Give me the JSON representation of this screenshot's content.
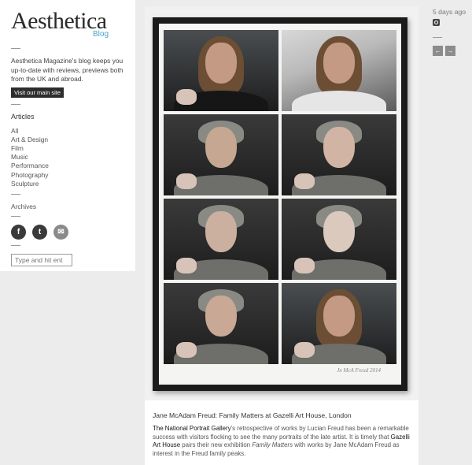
{
  "brand": {
    "name": "Aesthetica",
    "sub": "Blog"
  },
  "sidebar": {
    "intro": "Aesthetica Magazine's blog keeps you up-to-date with reviews, previews both from the UK and abroad.",
    "main_site_button": "Visit our main site",
    "articles_heading": "Articles",
    "categories": [
      "All",
      "Art & Design",
      "Film",
      "Music",
      "Performance",
      "Photography",
      "Sculpture"
    ],
    "archives": "Archives",
    "social": [
      {
        "icon": "facebook-icon",
        "glyph": "f"
      },
      {
        "icon": "twitter-icon",
        "glyph": "t"
      },
      {
        "icon": "email-icon",
        "glyph": "✉"
      }
    ],
    "search_placeholder": "Type and hit ent"
  },
  "artwork": {
    "signature": "Jn McA Freud  2014"
  },
  "caption": {
    "title": "Jane McAdam Freud: Family Matters at Gazelli Art House, London",
    "link1": "The National Portrait Gallery",
    "text1": "’s retrospective of works by Lucian Freud has been a remarkable success with visitors flocking to see the many portraits of the late artist. It is timely that ",
    "link2": "Gazelli Art House",
    "text2": " pairs their new exhibition ",
    "italic": "Family Matters",
    "text3": " with works by Jane McAdam Freud as interest in the Freud family peaks."
  },
  "meta": {
    "time_ago": "5 days ago",
    "prev": "←",
    "next": "→"
  }
}
